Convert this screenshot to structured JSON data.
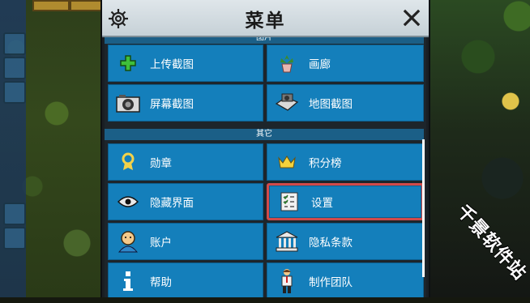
{
  "menu": {
    "title": "菜单",
    "sections": {
      "images_header": "图片",
      "other_header": "其它"
    },
    "items": {
      "upload_screenshot": "上传截图",
      "gallery": "画廊",
      "screenshot": "屏幕截图",
      "map_screenshot": "地图截图",
      "achievements": "勋章",
      "leaderboard": "积分榜",
      "hide_ui": "隐藏界面",
      "settings": "设置",
      "account": "账户",
      "privacy": "隐私条款",
      "help": "帮助",
      "credits": "制作团队"
    }
  },
  "watermark": "千景软件站",
  "colors": {
    "button_blue": "#147fbb",
    "section_blue": "#1b5f87",
    "highlight_red": "#d24a4a",
    "header_gray": "#dfe6ea"
  }
}
